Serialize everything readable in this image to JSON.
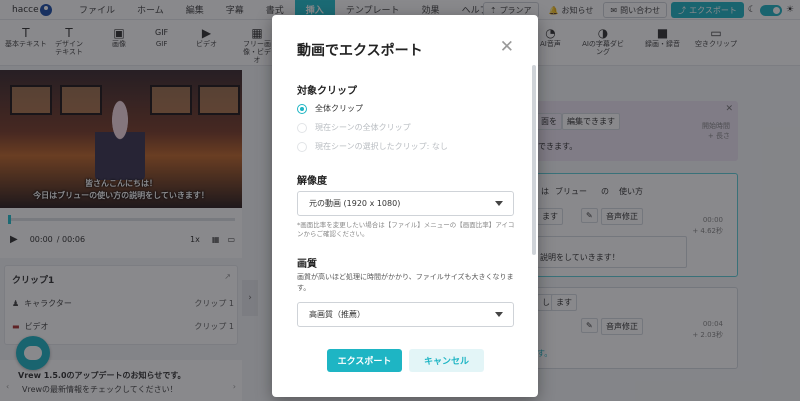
{
  "menubar": {
    "app_name": "hacce",
    "items": [
      "ファイル",
      "ホーム",
      "編集",
      "字幕",
      "書式",
      "挿入",
      "テンプレート",
      "効果",
      "ヘルプ"
    ],
    "active_index": 5,
    "plan_label": "プランア",
    "notice_label": "お知らせ",
    "contact_label": "問い合わせ",
    "export_label": "エクスポート"
  },
  "toolbar": {
    "tools": [
      "基本テキスト",
      "デザインテキスト",
      "画像",
      "GIF",
      "ビデオ",
      "フリー画像・ビデオ",
      "AI音声",
      "AIの字幕ダビング",
      "録画・録音",
      "空きクリップ"
    ],
    "gif_glyph": "GIF"
  },
  "player": {
    "subtitle_line1": "皆さんこんにちは！",
    "subtitle_line2": "今日はブリューの使い方の説明をしていきます！",
    "time_current": "00:00",
    "time_total": "/ 00:06",
    "speed": "1x",
    "progress": 0.0
  },
  "clip_panel": {
    "title": "クリップ1",
    "rows": [
      {
        "label": "キャラクター",
        "value": "クリップ 1"
      },
      {
        "label": "ビデオ",
        "value": "クリップ 1"
      }
    ]
  },
  "notice": {
    "title": "Vrew 1.5.0のアップデートのお知らせです。",
    "body": "Vrewの最新情報をチェックしてください！"
  },
  "background_editor": {
    "hint_chips": [
      "面を",
      "編集できます"
    ],
    "hint_text": "できます。",
    "hint_side_1": "開始時間",
    "hint_side_2": "+ 長さ",
    "card1_words": [
      "は",
      "ブリュー",
      "の",
      "使い方"
    ],
    "card1_word_masu": "ます",
    "card1_fix": "音声修正",
    "card1_time": "00:00",
    "card1_len": "+ 4.62秒",
    "card1_line": "説明をしていきます！",
    "card2_words": [
      "し",
      "ます"
    ],
    "card2_fix": "音声修正",
    "card2_time": "00:04",
    "card2_len": "+ 2.03秒",
    "card2_tail": "す。"
  },
  "modal": {
    "title": "動画でエクスポート",
    "section_clip": "対象クリップ",
    "radio_options": [
      {
        "label": "全体クリップ",
        "selected": true,
        "disabled": false
      },
      {
        "label": "現在シーンの全体クリップ",
        "selected": false,
        "disabled": true
      },
      {
        "label": "現在シーンの選択したクリップ: なし",
        "selected": false,
        "disabled": true
      }
    ],
    "section_resolution": "解像度",
    "resolution_value": "元の動画 (1920 x 1080)",
    "resolution_note": "*画面比率を変更したい場合は【ファイル】メニューの【画面比率】アイコンからご確認ください。",
    "section_quality": "画質",
    "quality_desc": "画質が高いほど処理に時間がかかり、ファイルサイズも大きくなります。",
    "quality_value": "高画質（推薦）",
    "export_button": "エクスポート",
    "cancel_button": "キャンセル"
  }
}
